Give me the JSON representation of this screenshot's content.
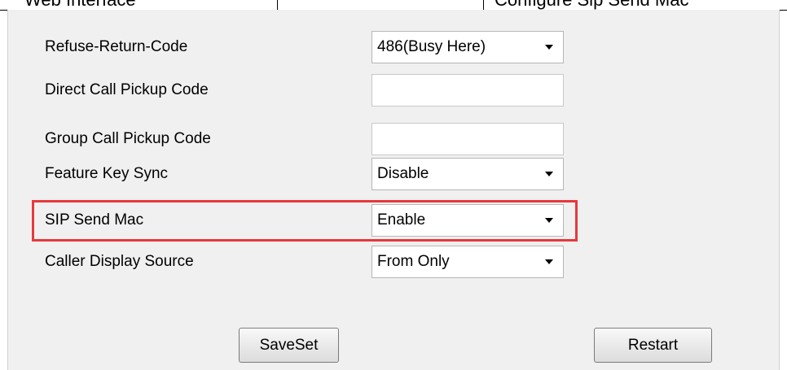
{
  "top_table": {
    "cell_left": "Web Interface",
    "cell_right": "Configure Sip Send Mac"
  },
  "form": {
    "rows": [
      {
        "label": "Refuse-Return-Code",
        "control": "select",
        "value": "486(Busy Here)"
      },
      {
        "label": "Direct Call Pickup Code",
        "control": "input",
        "value": ""
      },
      {
        "label": "Group Call Pickup Code",
        "control": "input",
        "value": ""
      },
      {
        "label": "Feature Key Sync",
        "control": "select",
        "value": "Disable"
      },
      {
        "label": "SIP Send Mac",
        "control": "select",
        "value": "Enable",
        "highlighted": true
      },
      {
        "label": "Caller Display Source",
        "control": "select",
        "value": "From Only"
      }
    ]
  },
  "buttons": {
    "save_label": "SaveSet",
    "restart_label": "Restart"
  },
  "colors": {
    "panel_background": "#f0f0f0",
    "highlight_border": "#e8383d"
  }
}
